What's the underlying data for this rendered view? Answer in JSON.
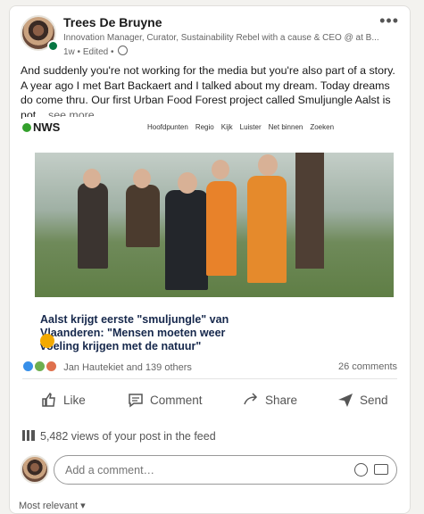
{
  "post": {
    "author": "Trees De Bruyne",
    "headline": "Innovation Manager, Curator, Sustainability Rebel with a cause & CEO @ at B...",
    "meta": "1w • Edited •",
    "body": "And suddenly you're not working for the media but you're also part of a story. A year ago I met Bart Backaert and I talked about my dream. Today dreams do come thru. Our first Urban Food Forest project called Smuljungle Aalst is not",
    "see_more": "...see more"
  },
  "article": {
    "source": "NWS",
    "nav": [
      "Hoofdpunten",
      "Regio",
      "Kijk",
      "Luister",
      "Net binnen",
      "Zoeken"
    ],
    "title": "Aalst krijgt eerste \"smuljungle\" van Vlaanderen: \"Mensen moeten weer voeling krijgen met de natuur\""
  },
  "social": {
    "reactions": "Jan Hautekiet and 139 others",
    "comments": "26 comments"
  },
  "actions": {
    "like": "Like",
    "comment": "Comment",
    "share": "Share",
    "send": "Send"
  },
  "views": "5,482 views of your post in the feed",
  "comment_placeholder": "Add a comment…",
  "sort": "Most relevant ▾"
}
